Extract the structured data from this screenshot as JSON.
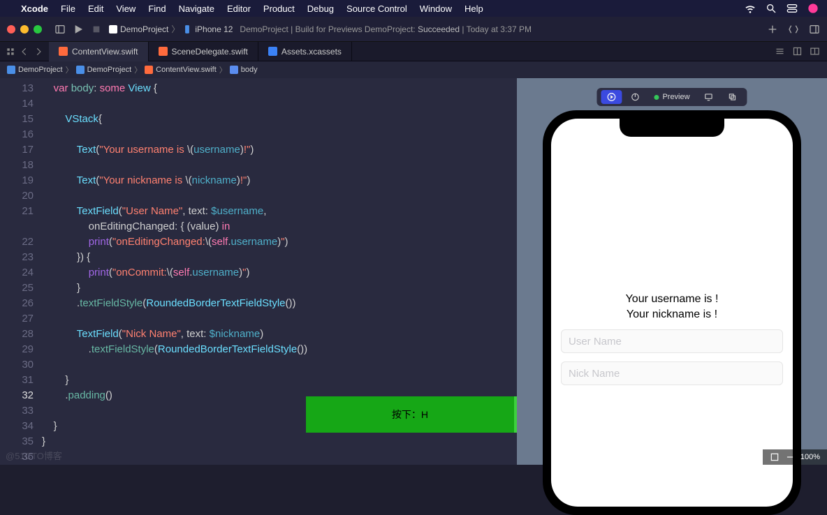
{
  "menubar": {
    "app": "Xcode",
    "items": [
      "File",
      "Edit",
      "View",
      "Find",
      "Navigate",
      "Editor",
      "Product",
      "Debug",
      "Source Control",
      "Window",
      "Help"
    ]
  },
  "toolbar": {
    "scheme_project": "DemoProject",
    "scheme_device": "iPhone 12",
    "status_prefix": "DemoProject | Build for Previews DemoProject: ",
    "status_result": "Succeeded",
    "status_time": " | Today at 3:37 PM"
  },
  "tabs": [
    {
      "label": "ContentView.swift",
      "icon": "swift",
      "active": true
    },
    {
      "label": "SceneDelegate.swift",
      "icon": "swift",
      "active": false
    },
    {
      "label": "Assets.xcassets",
      "icon": "assets",
      "active": false
    }
  ],
  "breadcrumbs": [
    "DemoProject",
    "DemoProject",
    "ContentView.swift",
    "body"
  ],
  "editor": {
    "first_line": 13,
    "current_line": 32,
    "lines": [
      {
        "n": 13,
        "seg": [
          {
            "c": "k-var",
            "t": "    var"
          },
          {
            "c": "k-pl",
            "t": " "
          },
          {
            "c": "k-prop",
            "t": "body"
          },
          {
            "c": "k-pl",
            "t": ": "
          },
          {
            "c": "k-var",
            "t": "some"
          },
          {
            "c": "k-pl",
            "t": " "
          },
          {
            "c": "k-type",
            "t": "View"
          },
          {
            "c": "k-pl",
            "t": " {"
          }
        ]
      },
      {
        "n": 14,
        "seg": [
          {
            "c": "k-pl",
            "t": ""
          }
        ]
      },
      {
        "n": 15,
        "seg": [
          {
            "c": "k-pl",
            "t": "        "
          },
          {
            "c": "k-type",
            "t": "VStack"
          },
          {
            "c": "k-pl",
            "t": "{"
          }
        ]
      },
      {
        "n": 16,
        "seg": [
          {
            "c": "k-pl",
            "t": ""
          }
        ]
      },
      {
        "n": 17,
        "seg": [
          {
            "c": "k-pl",
            "t": "            "
          },
          {
            "c": "k-type",
            "t": "Text"
          },
          {
            "c": "k-pl",
            "t": "("
          },
          {
            "c": "k-str",
            "t": "\"Your username is "
          },
          {
            "c": "k-pl",
            "t": "\\("
          },
          {
            "c": "k-id",
            "t": "username"
          },
          {
            "c": "k-pl",
            "t": ")"
          },
          {
            "c": "k-str",
            "t": "!\""
          },
          {
            "c": "k-pl",
            "t": ")"
          }
        ]
      },
      {
        "n": 18,
        "seg": [
          {
            "c": "k-pl",
            "t": ""
          }
        ]
      },
      {
        "n": 19,
        "seg": [
          {
            "c": "k-pl",
            "t": "            "
          },
          {
            "c": "k-type",
            "t": "Text"
          },
          {
            "c": "k-pl",
            "t": "("
          },
          {
            "c": "k-str",
            "t": "\"Your nickname is "
          },
          {
            "c": "k-pl",
            "t": "\\("
          },
          {
            "c": "k-id",
            "t": "nickname"
          },
          {
            "c": "k-pl",
            "t": ")"
          },
          {
            "c": "k-str",
            "t": "!\""
          },
          {
            "c": "k-pl",
            "t": ")"
          }
        ]
      },
      {
        "n": 20,
        "seg": [
          {
            "c": "k-pl",
            "t": ""
          }
        ]
      },
      {
        "n": 21,
        "seg": [
          {
            "c": "k-pl",
            "t": "            "
          },
          {
            "c": "k-type",
            "t": "TextField"
          },
          {
            "c": "k-pl",
            "t": "("
          },
          {
            "c": "k-str",
            "t": "\"User Name\""
          },
          {
            "c": "k-pl",
            "t": ", text: "
          },
          {
            "c": "k-id",
            "t": "$username"
          },
          {
            "c": "k-pl",
            "t": ","
          },
          {
            "c": "",
            "t": "\n"
          },
          {
            "c": "k-pl",
            "t": "                onEditingChanged: { (value) "
          },
          {
            "c": "k-in",
            "t": "in"
          }
        ]
      },
      {
        "n": 22,
        "seg": [
          {
            "c": "k-pl",
            "t": "                "
          },
          {
            "c": "k-fn",
            "t": "print"
          },
          {
            "c": "k-pl",
            "t": "("
          },
          {
            "c": "k-str",
            "t": "\"onEditingChanged:"
          },
          {
            "c": "k-pl",
            "t": "\\("
          },
          {
            "c": "k-in",
            "t": "self"
          },
          {
            "c": "k-pl",
            "t": "."
          },
          {
            "c": "k-id",
            "t": "username"
          },
          {
            "c": "k-pl",
            "t": ")"
          },
          {
            "c": "k-str",
            "t": "\""
          },
          {
            "c": "k-pl",
            "t": ")"
          }
        ]
      },
      {
        "n": 23,
        "seg": [
          {
            "c": "k-pl",
            "t": "            }) {"
          }
        ]
      },
      {
        "n": 24,
        "seg": [
          {
            "c": "k-pl",
            "t": "                "
          },
          {
            "c": "k-fn",
            "t": "print"
          },
          {
            "c": "k-pl",
            "t": "("
          },
          {
            "c": "k-str",
            "t": "\"onCommit:"
          },
          {
            "c": "k-pl",
            "t": "\\("
          },
          {
            "c": "k-in",
            "t": "self"
          },
          {
            "c": "k-pl",
            "t": "."
          },
          {
            "c": "k-id",
            "t": "username"
          },
          {
            "c": "k-pl",
            "t": ")"
          },
          {
            "c": "k-str",
            "t": "\""
          },
          {
            "c": "k-pl",
            "t": ")"
          }
        ]
      },
      {
        "n": 25,
        "seg": [
          {
            "c": "k-pl",
            "t": "            }"
          }
        ]
      },
      {
        "n": 26,
        "seg": [
          {
            "c": "k-pl",
            "t": "            ."
          },
          {
            "c": "k-fn2",
            "t": "textFieldStyle"
          },
          {
            "c": "k-pl",
            "t": "("
          },
          {
            "c": "k-type",
            "t": "RoundedBorderTextFieldStyle"
          },
          {
            "c": "k-pl",
            "t": "())"
          }
        ]
      },
      {
        "n": 27,
        "seg": [
          {
            "c": "k-pl",
            "t": ""
          }
        ]
      },
      {
        "n": 28,
        "seg": [
          {
            "c": "k-pl",
            "t": "            "
          },
          {
            "c": "k-type",
            "t": "TextField"
          },
          {
            "c": "k-pl",
            "t": "("
          },
          {
            "c": "k-str",
            "t": "\"Nick Name\""
          },
          {
            "c": "k-pl",
            "t": ", text: "
          },
          {
            "c": "k-id",
            "t": "$nickname"
          },
          {
            "c": "k-pl",
            "t": ")"
          }
        ]
      },
      {
        "n": 29,
        "seg": [
          {
            "c": "k-pl",
            "t": "                ."
          },
          {
            "c": "k-fn2",
            "t": "textFieldStyle"
          },
          {
            "c": "k-pl",
            "t": "("
          },
          {
            "c": "k-type",
            "t": "RoundedBorderTextFieldStyle"
          },
          {
            "c": "k-pl",
            "t": "())"
          }
        ]
      },
      {
        "n": 30,
        "seg": [
          {
            "c": "k-pl",
            "t": ""
          }
        ]
      },
      {
        "n": 31,
        "seg": [
          {
            "c": "k-pl",
            "t": "        }"
          }
        ]
      },
      {
        "n": 32,
        "seg": [
          {
            "c": "k-pl",
            "t": "        ."
          },
          {
            "c": "k-fn2",
            "t": "padding"
          },
          {
            "c": "k-pl",
            "t": "()"
          }
        ]
      },
      {
        "n": 33,
        "seg": [
          {
            "c": "k-pl",
            "t": ""
          }
        ]
      },
      {
        "n": 34,
        "seg": [
          {
            "c": "k-pl",
            "t": "    }"
          }
        ]
      },
      {
        "n": 35,
        "seg": [
          {
            "c": "k-pl",
            "t": "}"
          }
        ]
      },
      {
        "n": 36,
        "seg": [
          {
            "c": "k-pl",
            "t": ""
          }
        ]
      }
    ]
  },
  "overlay": {
    "text": "按下：H"
  },
  "preview": {
    "label": "Preview",
    "sim_text1": "Your username is !",
    "sim_text2": "Your nickname is !",
    "placeholder1": "User Name",
    "placeholder2": "Nick Name"
  },
  "dock": {
    "zoom": "100%"
  },
  "watermark": "@51CTO博客"
}
